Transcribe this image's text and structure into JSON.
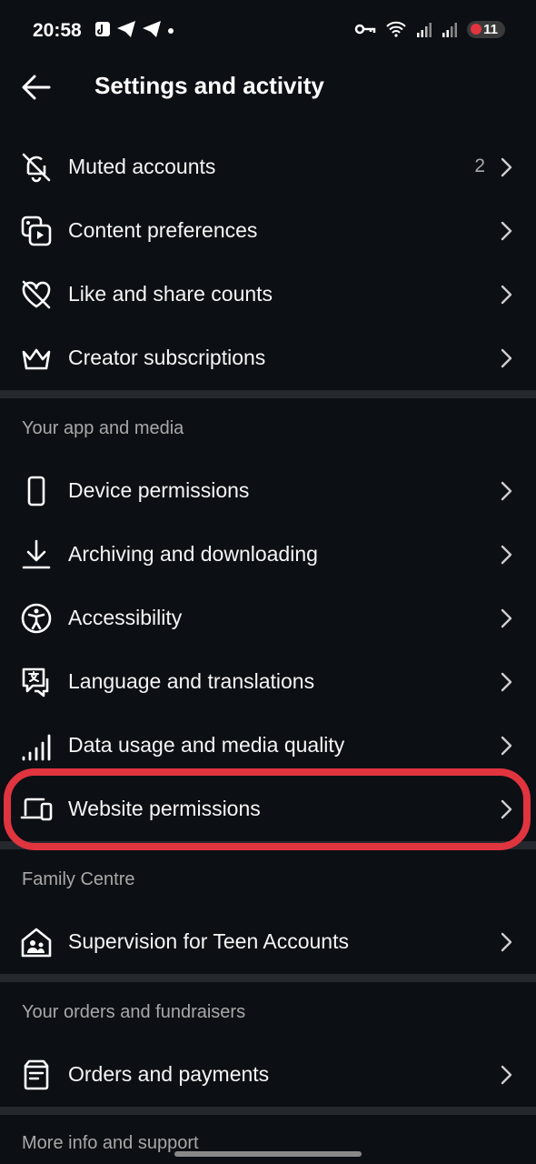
{
  "status": {
    "time": "20:58",
    "battery": "11"
  },
  "header": {
    "title": "Settings and activity"
  },
  "rows": {
    "muted": {
      "label": "Muted accounts",
      "count": "2"
    },
    "content_prefs": {
      "label": "Content preferences"
    },
    "like_share": {
      "label": "Like and share counts"
    },
    "creator_subs": {
      "label": "Creator subscriptions"
    },
    "device_perm": {
      "label": "Device permissions"
    },
    "archiving": {
      "label": "Archiving and downloading"
    },
    "accessibility": {
      "label": "Accessibility"
    },
    "language": {
      "label": "Language and translations"
    },
    "data_usage": {
      "label": "Data usage and media quality"
    },
    "website_perm": {
      "label": "Website permissions"
    },
    "supervision": {
      "label": "Supervision for Teen Accounts"
    },
    "orders": {
      "label": "Orders and payments"
    }
  },
  "sections": {
    "app_media": "Your app and media",
    "family": "Family Centre",
    "orders": "Your orders and fundraisers",
    "more_info": "More info and support"
  },
  "colors": {
    "background": "#0c0f14",
    "divider": "#25282d",
    "highlight": "#e0343f"
  }
}
